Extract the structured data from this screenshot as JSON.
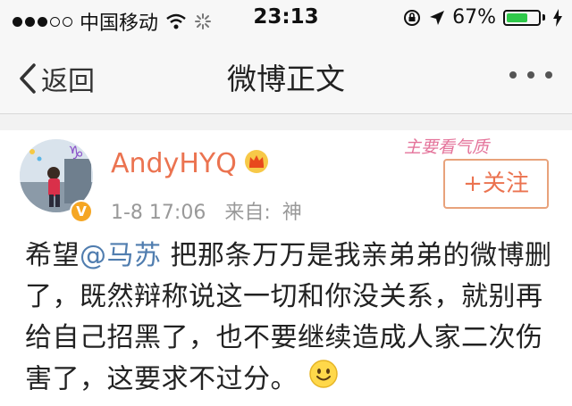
{
  "status_bar": {
    "carrier": "中国移动",
    "time": "23:13",
    "battery_percent": "67%",
    "battery_level": 0.67
  },
  "nav": {
    "back_label": "返回",
    "title": "微博正文"
  },
  "post": {
    "username": "AndyHYQ",
    "date": "1-8 17:06",
    "source_prefix": "来自:",
    "source": "神",
    "follow_label": "+关注",
    "watermark": "主要看气质",
    "text_before_mention": "希望",
    "mention": "@马苏",
    "text_after_mention": " 把那条万万是我亲弟弟的微博删了，既然辩称说这一切和你没关系，就别再给自己招黑了，也不要继续造成人家二次伤害了，这要求不过分。",
    "emoji_icon": "smile-emoji-icon"
  },
  "colors": {
    "username": "#eb7350",
    "mention": "#507daf",
    "follow_border": "#e8a27b",
    "battery_fill": "#2fc94a"
  }
}
